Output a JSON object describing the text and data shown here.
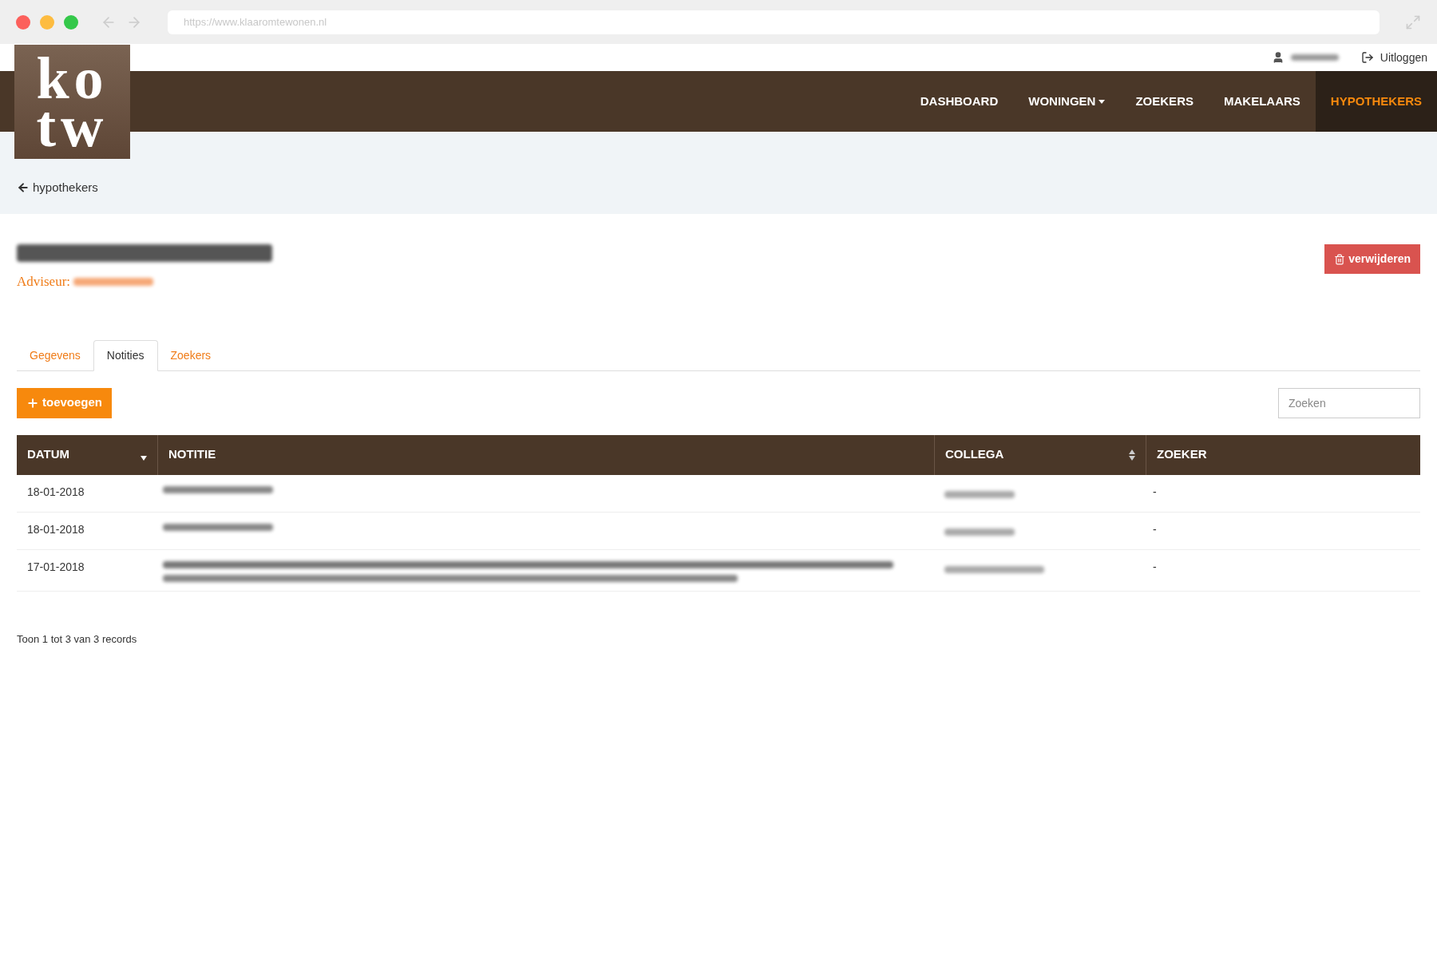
{
  "browser": {
    "url": "https://www.klaaromtewonen.nl"
  },
  "logo": {
    "lines": [
      "ko",
      "tw"
    ]
  },
  "topbar": {
    "logout": "Uitloggen"
  },
  "nav": [
    {
      "label": "DASHBOARD",
      "selected": false,
      "dropdown": false
    },
    {
      "label": "WONINGEN",
      "selected": false,
      "dropdown": true
    },
    {
      "label": "ZOEKERS",
      "selected": false,
      "dropdown": false
    },
    {
      "label": "MAKELAARS",
      "selected": false,
      "dropdown": false
    },
    {
      "label": "HYPOTHEKERS",
      "selected": true,
      "dropdown": false
    }
  ],
  "back_link": "hypothekers",
  "header": {
    "adviseur_label": "Adviseur:",
    "delete_button": "verwijderen"
  },
  "tabs": [
    {
      "label": "Gegevens",
      "selected": false
    },
    {
      "label": "Notities",
      "selected": true
    },
    {
      "label": "Zoekers",
      "selected": false
    }
  ],
  "add_button": "toevoegen",
  "search": {
    "placeholder": "Zoeken"
  },
  "table": {
    "columns": [
      {
        "label": "DATUM",
        "kind": "descending"
      },
      {
        "label": "NOTITIE",
        "kind": "plain"
      },
      {
        "label": "COLLEGA",
        "kind": "sortable"
      },
      {
        "label": "ZOEKER",
        "kind": "plain"
      }
    ],
    "rows": [
      {
        "datum": "18-01-2018",
        "zoeker": "-",
        "kind": "short"
      },
      {
        "datum": "18-01-2018",
        "zoeker": "-",
        "kind": "short"
      },
      {
        "datum": "17-01-2018",
        "zoeker": "-",
        "kind": "long"
      }
    ]
  },
  "footer": "Toon 1 tot 3 van 3 records"
}
